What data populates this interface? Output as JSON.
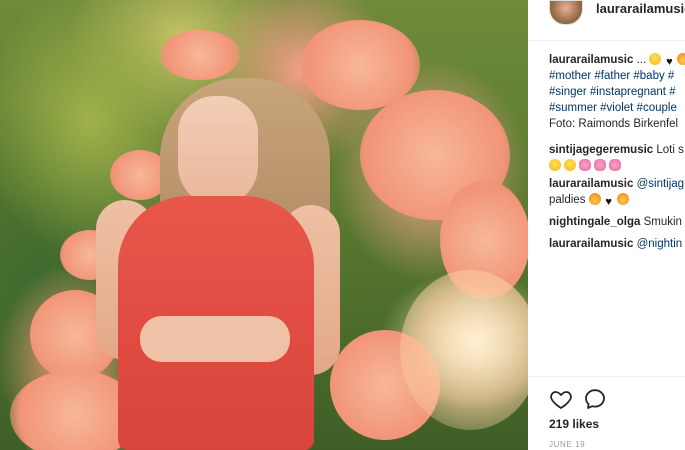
{
  "post_header": {
    "username": "laurarailamusic"
  },
  "caption": {
    "username": "laurarailamusic",
    "text_start": " ...",
    "hashtags_line1": "#mother #father #baby #",
    "hashtags_line2": "#singer #instapregnant #",
    "hashtags_line3": "#summer #violet #couple",
    "photo_credit": "Foto: Raimonds Birkenfel"
  },
  "comments": [
    {
      "username": "sintijagegeremusic",
      "text": " Loti s"
    },
    {
      "username": "laurarailamusic",
      "text": " @sintijag",
      "continuation": "paldies"
    },
    {
      "username": "nightingale_olga",
      "text": " Smukin"
    },
    {
      "username": "laurarailamusic",
      "text": " @nightin"
    }
  ],
  "actions": {
    "like_icon": "heart-outline-icon",
    "comment_icon": "speech-bubble-icon"
  },
  "likes": "219 likes",
  "date": "JUNE 19",
  "colors": {
    "hashtag": "#003569",
    "text": "#262626",
    "muted": "#999999",
    "dress": "#e24d43"
  }
}
